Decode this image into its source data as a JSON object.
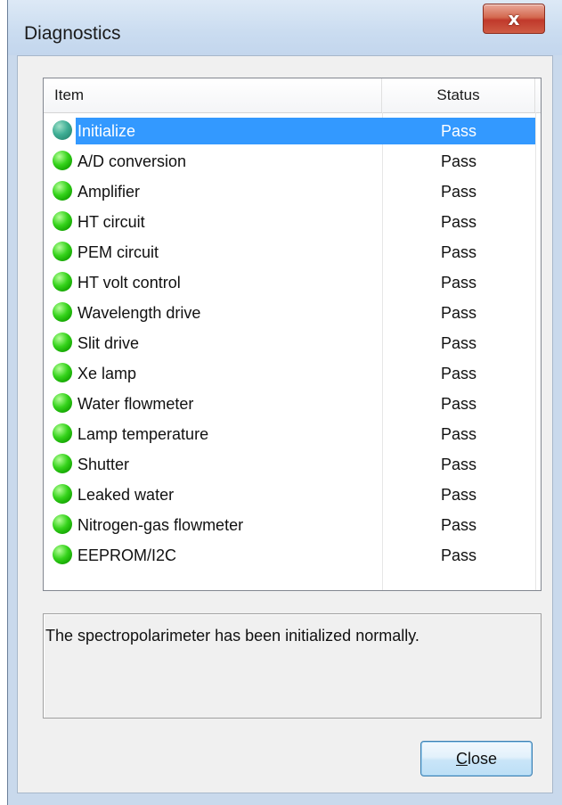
{
  "window": {
    "title": "Diagnostics",
    "close_glyph": "x"
  },
  "list": {
    "columns": [
      "Item",
      "Status"
    ],
    "rows": [
      {
        "item": "Initialize",
        "status": "Pass",
        "selected": true
      },
      {
        "item": "A/D conversion",
        "status": "Pass"
      },
      {
        "item": "Amplifier",
        "status": "Pass"
      },
      {
        "item": "HT circuit",
        "status": "Pass"
      },
      {
        "item": "PEM circuit",
        "status": "Pass"
      },
      {
        "item": "HT volt control",
        "status": "Pass"
      },
      {
        "item": "Wavelength drive",
        "status": "Pass"
      },
      {
        "item": "Slit drive",
        "status": "Pass"
      },
      {
        "item": "Xe lamp",
        "status": "Pass"
      },
      {
        "item": "Water flowmeter",
        "status": "Pass"
      },
      {
        "item": "Lamp temperature",
        "status": "Pass"
      },
      {
        "item": "Shutter",
        "status": "Pass"
      },
      {
        "item": "Leaked water",
        "status": "Pass"
      },
      {
        "item": "Nitrogen-gas flowmeter",
        "status": "Pass"
      },
      {
        "item": "EEPROM/I2C",
        "status": "Pass"
      }
    ],
    "status_icon": "green-status-dot-icon",
    "selection_color": "#3399ff",
    "pass_color": "#35d31b"
  },
  "message": "The spectropolarimeter has been initialized normally.",
  "close_button": {
    "label_mnemonic": "C",
    "label_rest": "lose"
  }
}
